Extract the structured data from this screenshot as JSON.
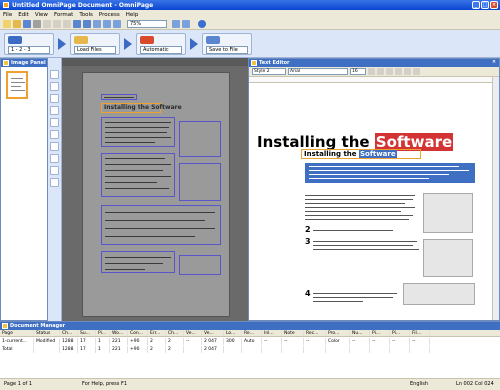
{
  "window": {
    "title": "Untitled OmniPage Document - OmniPage"
  },
  "menu": [
    "File",
    "Edit",
    "View",
    "Format",
    "Tools",
    "Process",
    "Help"
  ],
  "toolbar": {
    "zoom": "75%"
  },
  "workflow": {
    "page_range": "1 - 2 - 3",
    "load_files": "Load Files",
    "layout": "Automatic",
    "save": "Save to File"
  },
  "panels": {
    "page_panel_title": "Image Panel",
    "text_editor_title": "Text Editor",
    "doc_manager_title": "Document Manager"
  },
  "image_page": {
    "heading": "Installing the Software",
    "small_label": "Installing the Software"
  },
  "text_editor": {
    "style": "Style 2",
    "font": "Arial",
    "size": "16",
    "heading_plain": "Installing the ",
    "heading_highlight": "Software",
    "sub_plain": "Installing the ",
    "sub_highlight": "Software",
    "step2": "2",
    "step3": "3",
    "step4": "4"
  },
  "doc_manager": {
    "columns": [
      "Page",
      "Status",
      "Ch...",
      "Su...",
      "Pi...",
      "Wo...",
      "Con...",
      "Err...",
      "Ch...",
      "Ve...",
      "Ve...",
      "Lo...",
      "Re...",
      "Inl...",
      "Note",
      "Rec...",
      "Pro...",
      "Nu...",
      "Pi...",
      "Pi...",
      "Fil..."
    ],
    "rows": [
      [
        "1-current...",
        "Modified",
        "1288",
        "17",
        "1",
        "221",
        "+90",
        "2",
        "2",
        "--",
        "2 047",
        "300",
        "Auto",
        "--",
        "--",
        "--",
        "Color",
        "--",
        "--",
        "--",
        "--"
      ],
      [
        "Total",
        "",
        "1288",
        "17",
        "1",
        "221",
        "+90",
        "2",
        "2",
        "",
        "2 047",
        "",
        "",
        "",
        "",
        "",
        "",
        "",
        "",
        "",
        ""
      ]
    ]
  },
  "status": {
    "page": "Page 1 of 1",
    "help": "For Help, press F1",
    "language": "English",
    "position": "Ln 002 Col 024"
  },
  "colors": {
    "accent": "#3e6fc2",
    "titlebar": "#0a46d0",
    "highlight": "#d43333",
    "zone_border": "#5a55c8",
    "selection": "#f0a030"
  }
}
